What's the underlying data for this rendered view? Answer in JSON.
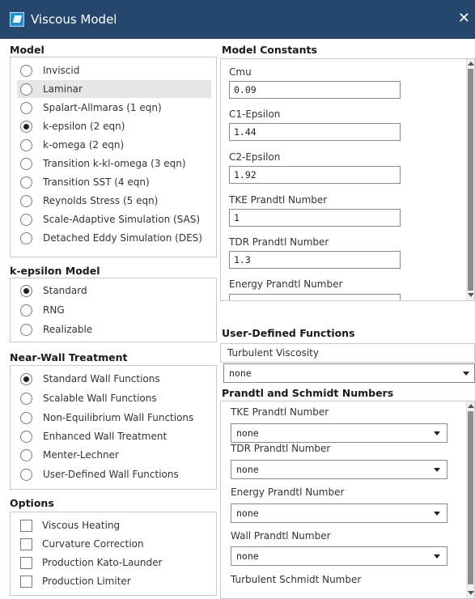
{
  "window": {
    "title": "Viscous Model",
    "close_glyph": "✕"
  },
  "model": {
    "title": "Model",
    "options": [
      {
        "label": "Inviscid",
        "selected": false
      },
      {
        "label": "Laminar",
        "selected": false
      },
      {
        "label": "Spalart-Allmaras (1 eqn)",
        "selected": false
      },
      {
        "label": "k-epsilon (2 eqn)",
        "selected": true
      },
      {
        "label": "k-omega (2 eqn)",
        "selected": false
      },
      {
        "label": "Transition k-kl-omega (3 eqn)",
        "selected": false
      },
      {
        "label": "Transition SST (4 eqn)",
        "selected": false
      },
      {
        "label": "Reynolds Stress (5 eqn)",
        "selected": false
      },
      {
        "label": "Scale-Adaptive Simulation (SAS)",
        "selected": false
      },
      {
        "label": "Detached Eddy Simulation (DES)",
        "selected": false
      }
    ]
  },
  "kepsilon": {
    "title": "k-epsilon Model",
    "options": [
      {
        "label": "Standard",
        "selected": true
      },
      {
        "label": "RNG",
        "selected": false
      },
      {
        "label": "Realizable",
        "selected": false
      }
    ]
  },
  "nearwall": {
    "title": "Near-Wall Treatment",
    "options": [
      {
        "label": "Standard Wall Functions",
        "selected": true
      },
      {
        "label": "Scalable Wall Functions",
        "selected": false
      },
      {
        "label": "Non-Equilibrium Wall Functions",
        "selected": false
      },
      {
        "label": "Enhanced Wall Treatment",
        "selected": false
      },
      {
        "label": "Menter-Lechner",
        "selected": false
      },
      {
        "label": "User-Defined Wall Functions",
        "selected": false
      }
    ]
  },
  "options": {
    "title": "Options",
    "items": [
      {
        "label": "Viscous Heating",
        "checked": false
      },
      {
        "label": "Curvature Correction",
        "checked": false
      },
      {
        "label": "Production Kato-Launder",
        "checked": false
      },
      {
        "label": "Production Limiter",
        "checked": false
      }
    ]
  },
  "constants": {
    "title": "Model Constants",
    "items": [
      {
        "label": "Cmu",
        "value": "0.09"
      },
      {
        "label": "C1-Epsilon",
        "value": "1.44"
      },
      {
        "label": "C2-Epsilon",
        "value": "1.92"
      },
      {
        "label": "TKE Prandtl Number",
        "value": "1"
      },
      {
        "label": "TDR Prandtl Number",
        "value": "1.3"
      },
      {
        "label": "Energy Prandtl Number",
        "value": ""
      }
    ]
  },
  "udf": {
    "title": "User-Defined Functions",
    "turbulent_viscosity_label": "Turbulent Viscosity",
    "turbulent_viscosity_value": "none"
  },
  "psn": {
    "title": "Prandtl and Schmidt Numbers",
    "items": [
      {
        "label": "TKE Prandtl Number",
        "value": "none"
      },
      {
        "label": "TDR Prandtl Number",
        "value": "none"
      },
      {
        "label": "Energy Prandtl Number",
        "value": "none"
      },
      {
        "label": "Wall Prandtl Number",
        "value": "none"
      },
      {
        "label": "Turbulent Schmidt Number",
        "value": ""
      }
    ]
  }
}
